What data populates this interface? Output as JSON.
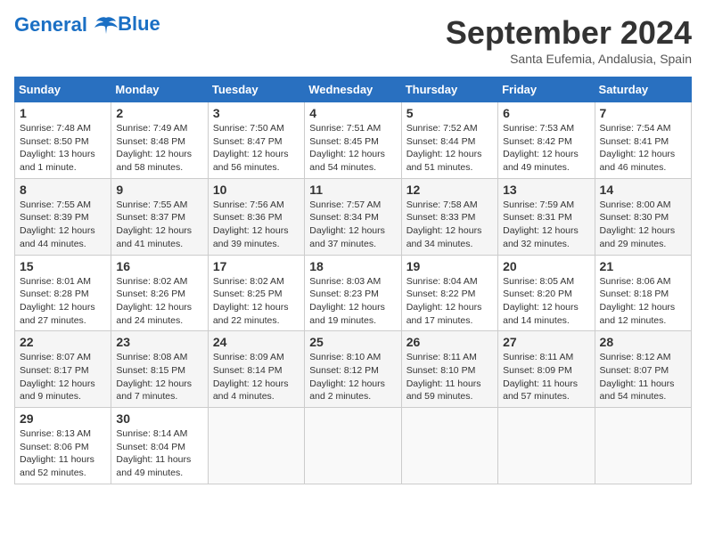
{
  "logo": {
    "line1": "General",
    "line2": "Blue"
  },
  "title": "September 2024",
  "subtitle": "Santa Eufemia, Andalusia, Spain",
  "weekdays": [
    "Sunday",
    "Monday",
    "Tuesday",
    "Wednesday",
    "Thursday",
    "Friday",
    "Saturday"
  ],
  "weeks": [
    [
      {
        "day": "1",
        "info": "Sunrise: 7:48 AM\nSunset: 8:50 PM\nDaylight: 13 hours\nand 1 minute."
      },
      {
        "day": "2",
        "info": "Sunrise: 7:49 AM\nSunset: 8:48 PM\nDaylight: 12 hours\nand 58 minutes."
      },
      {
        "day": "3",
        "info": "Sunrise: 7:50 AM\nSunset: 8:47 PM\nDaylight: 12 hours\nand 56 minutes."
      },
      {
        "day": "4",
        "info": "Sunrise: 7:51 AM\nSunset: 8:45 PM\nDaylight: 12 hours\nand 54 minutes."
      },
      {
        "day": "5",
        "info": "Sunrise: 7:52 AM\nSunset: 8:44 PM\nDaylight: 12 hours\nand 51 minutes."
      },
      {
        "day": "6",
        "info": "Sunrise: 7:53 AM\nSunset: 8:42 PM\nDaylight: 12 hours\nand 49 minutes."
      },
      {
        "day": "7",
        "info": "Sunrise: 7:54 AM\nSunset: 8:41 PM\nDaylight: 12 hours\nand 46 minutes."
      }
    ],
    [
      {
        "day": "8",
        "info": "Sunrise: 7:55 AM\nSunset: 8:39 PM\nDaylight: 12 hours\nand 44 minutes."
      },
      {
        "day": "9",
        "info": "Sunrise: 7:55 AM\nSunset: 8:37 PM\nDaylight: 12 hours\nand 41 minutes."
      },
      {
        "day": "10",
        "info": "Sunrise: 7:56 AM\nSunset: 8:36 PM\nDaylight: 12 hours\nand 39 minutes."
      },
      {
        "day": "11",
        "info": "Sunrise: 7:57 AM\nSunset: 8:34 PM\nDaylight: 12 hours\nand 37 minutes."
      },
      {
        "day": "12",
        "info": "Sunrise: 7:58 AM\nSunset: 8:33 PM\nDaylight: 12 hours\nand 34 minutes."
      },
      {
        "day": "13",
        "info": "Sunrise: 7:59 AM\nSunset: 8:31 PM\nDaylight: 12 hours\nand 32 minutes."
      },
      {
        "day": "14",
        "info": "Sunrise: 8:00 AM\nSunset: 8:30 PM\nDaylight: 12 hours\nand 29 minutes."
      }
    ],
    [
      {
        "day": "15",
        "info": "Sunrise: 8:01 AM\nSunset: 8:28 PM\nDaylight: 12 hours\nand 27 minutes."
      },
      {
        "day": "16",
        "info": "Sunrise: 8:02 AM\nSunset: 8:26 PM\nDaylight: 12 hours\nand 24 minutes."
      },
      {
        "day": "17",
        "info": "Sunrise: 8:02 AM\nSunset: 8:25 PM\nDaylight: 12 hours\nand 22 minutes."
      },
      {
        "day": "18",
        "info": "Sunrise: 8:03 AM\nSunset: 8:23 PM\nDaylight: 12 hours\nand 19 minutes."
      },
      {
        "day": "19",
        "info": "Sunrise: 8:04 AM\nSunset: 8:22 PM\nDaylight: 12 hours\nand 17 minutes."
      },
      {
        "day": "20",
        "info": "Sunrise: 8:05 AM\nSunset: 8:20 PM\nDaylight: 12 hours\nand 14 minutes."
      },
      {
        "day": "21",
        "info": "Sunrise: 8:06 AM\nSunset: 8:18 PM\nDaylight: 12 hours\nand 12 minutes."
      }
    ],
    [
      {
        "day": "22",
        "info": "Sunrise: 8:07 AM\nSunset: 8:17 PM\nDaylight: 12 hours\nand 9 minutes."
      },
      {
        "day": "23",
        "info": "Sunrise: 8:08 AM\nSunset: 8:15 PM\nDaylight: 12 hours\nand 7 minutes."
      },
      {
        "day": "24",
        "info": "Sunrise: 8:09 AM\nSunset: 8:14 PM\nDaylight: 12 hours\nand 4 minutes."
      },
      {
        "day": "25",
        "info": "Sunrise: 8:10 AM\nSunset: 8:12 PM\nDaylight: 12 hours\nand 2 minutes."
      },
      {
        "day": "26",
        "info": "Sunrise: 8:11 AM\nSunset: 8:10 PM\nDaylight: 11 hours\nand 59 minutes."
      },
      {
        "day": "27",
        "info": "Sunrise: 8:11 AM\nSunset: 8:09 PM\nDaylight: 11 hours\nand 57 minutes."
      },
      {
        "day": "28",
        "info": "Sunrise: 8:12 AM\nSunset: 8:07 PM\nDaylight: 11 hours\nand 54 minutes."
      }
    ],
    [
      {
        "day": "29",
        "info": "Sunrise: 8:13 AM\nSunset: 8:06 PM\nDaylight: 11 hours\nand 52 minutes."
      },
      {
        "day": "30",
        "info": "Sunrise: 8:14 AM\nSunset: 8:04 PM\nDaylight: 11 hours\nand 49 minutes."
      },
      {
        "day": "",
        "info": ""
      },
      {
        "day": "",
        "info": ""
      },
      {
        "day": "",
        "info": ""
      },
      {
        "day": "",
        "info": ""
      },
      {
        "day": "",
        "info": ""
      }
    ]
  ]
}
